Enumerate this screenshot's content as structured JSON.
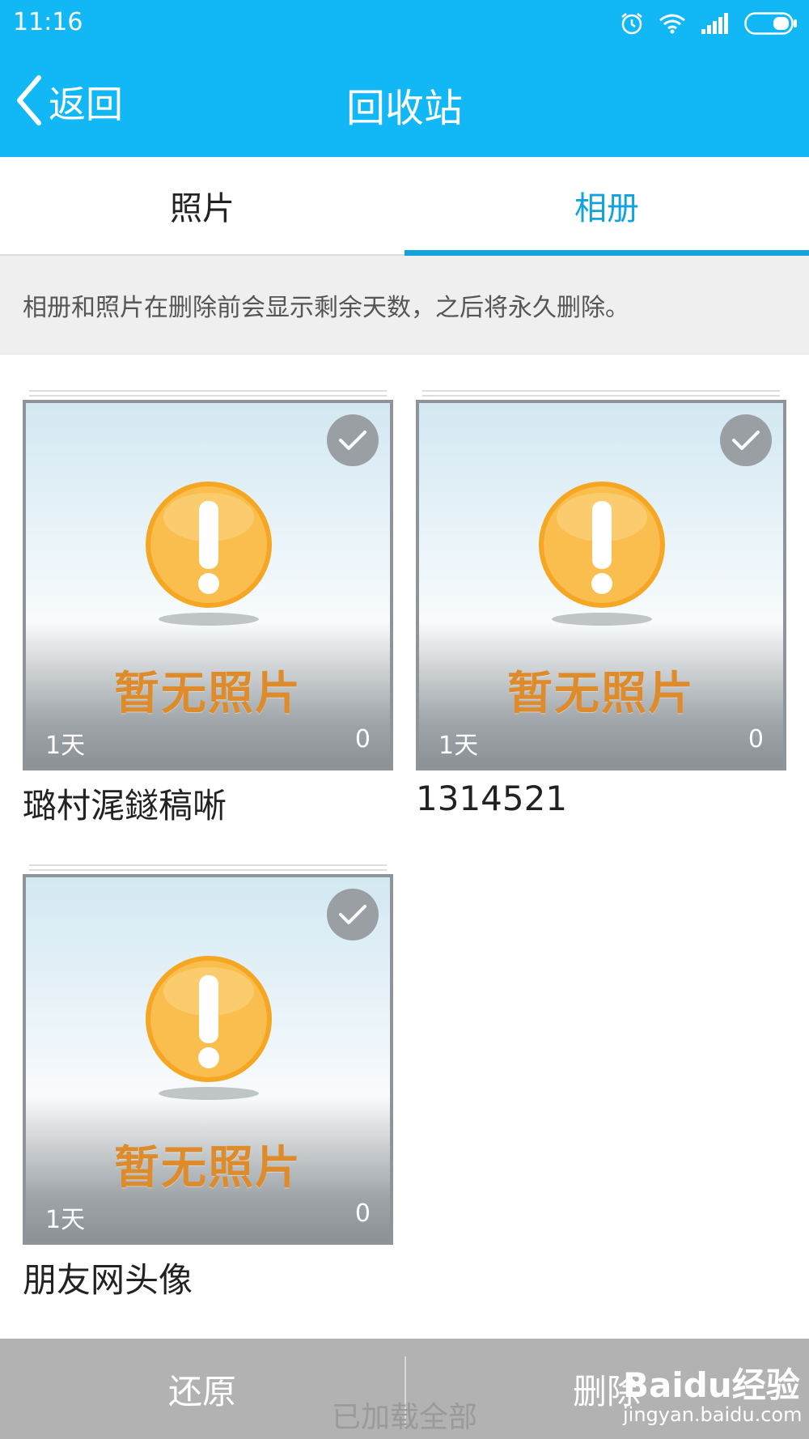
{
  "status_bar": {
    "time": "11:16",
    "icons": [
      "alarm-icon",
      "wifi-icon",
      "signal-icon",
      "battery-icon"
    ]
  },
  "header": {
    "back_label": "返回",
    "title": "回收站"
  },
  "tabs": [
    {
      "label": "照片",
      "active": false
    },
    {
      "label": "相册",
      "active": true
    }
  ],
  "notice": "相册和照片在删除前会显示剩余天数，之后将永久删除。",
  "albums": [
    {
      "name": "璐村浘鐩稿唽",
      "days_left": "1天",
      "photo_count": "0",
      "placeholder_text": "暂无照片",
      "selected": true
    },
    {
      "name": "1314521",
      "days_left": "1天",
      "photo_count": "0",
      "placeholder_text": "暂无照片",
      "selected": true
    },
    {
      "name": "朋友网头像",
      "days_left": "1天",
      "photo_count": "0",
      "placeholder_text": "暂无照片",
      "selected": true
    }
  ],
  "bottom_bar": {
    "restore_label": "还原",
    "delete_label": "删除"
  },
  "footer_status": "已加载全部",
  "watermark": {
    "main": "Baidu经验",
    "sub": "jingyan.baidu.com"
  },
  "colors": {
    "header_bg": "#12B7F5",
    "tab_active": "#12A3DF",
    "notice_bg": "#EFEFEF",
    "bottom_bar_bg": "#B2B2B2",
    "placeholder_text": "#DD8B2B",
    "warning_icon": "#F5A623"
  }
}
